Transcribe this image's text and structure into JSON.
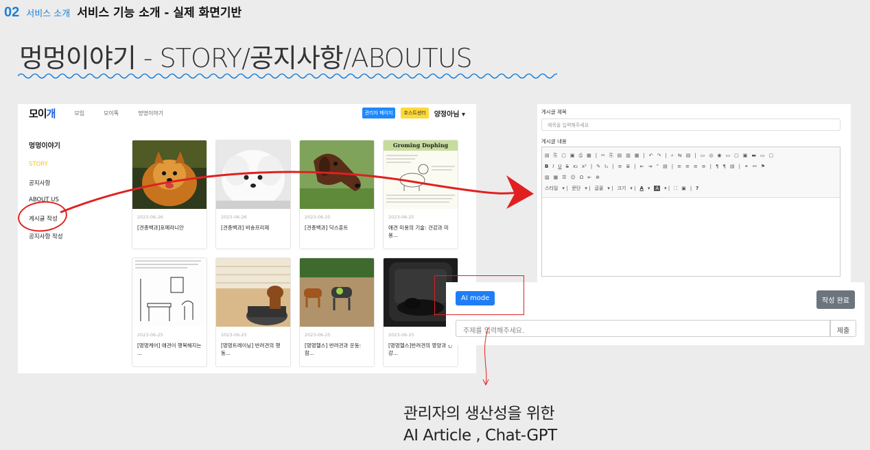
{
  "slide": {
    "number": "02",
    "section": "서비스 소개",
    "heading": "서비스 기능 소개 - 실제 화면기반",
    "title": "멍멍이야기 - STORY/공지사항/ABOUTUS"
  },
  "site": {
    "logo_a": "모이",
    "logo_b": "개",
    "nav": [
      "모임",
      "모이톡",
      "멍멍이야기"
    ],
    "admin_button": "관리자 페이지",
    "host_button": "호스트센터",
    "user": "양정아님 ▾"
  },
  "sidebar": {
    "title": "멍멍이야기",
    "items": [
      "STORY",
      "공지사항",
      "ABOUT US",
      "게시글 작성",
      "공지사항 작성"
    ]
  },
  "cards": [
    {
      "date": "2023-06-26",
      "title": "[견종백과]포메라니안"
    },
    {
      "date": "2023-06-26",
      "title": "[견종백과] 비숑프리제"
    },
    {
      "date": "2023-06-25",
      "title": "[견종백과] 닥스훈트"
    },
    {
      "date": "2023-06-25",
      "title": "애견 미용의 기술: 건강과 미용...",
      "img_text": "Groming Dophing"
    },
    {
      "date": "2023-06-25",
      "title": "[멍멍케어] 애견이 행복해지는 ..."
    },
    {
      "date": "2023-06-25",
      "title": "[멍멍트레이닝] 반려견의 행동..."
    },
    {
      "date": "2023-06-25",
      "title": "[멍멍헬스] 반려견과 운동: 함..."
    },
    {
      "date": "2023-06-25",
      "title": "[멍멍헬스]반려견의 영양과 건강..."
    }
  ],
  "editor": {
    "title_label": "게시글 제목",
    "title_placeholder": "제목을 입력해주세요",
    "content_label": "게시글 내용",
    "toolbar_row4": [
      "스타일",
      "문단",
      "글꼴",
      "크기"
    ]
  },
  "ai_panel": {
    "ai_mode": "AI mode",
    "done": "작성 완료",
    "topic_placeholder": "주제를 입력해주세요.",
    "submit": "제출"
  },
  "caption": {
    "line1": "관리자의 생산성을 위한",
    "line2": "AI Article , Chat-GPT"
  },
  "colors": {
    "accent": "#1e7fd6",
    "highlight": "#e02020",
    "story_active": "#ffc400"
  }
}
